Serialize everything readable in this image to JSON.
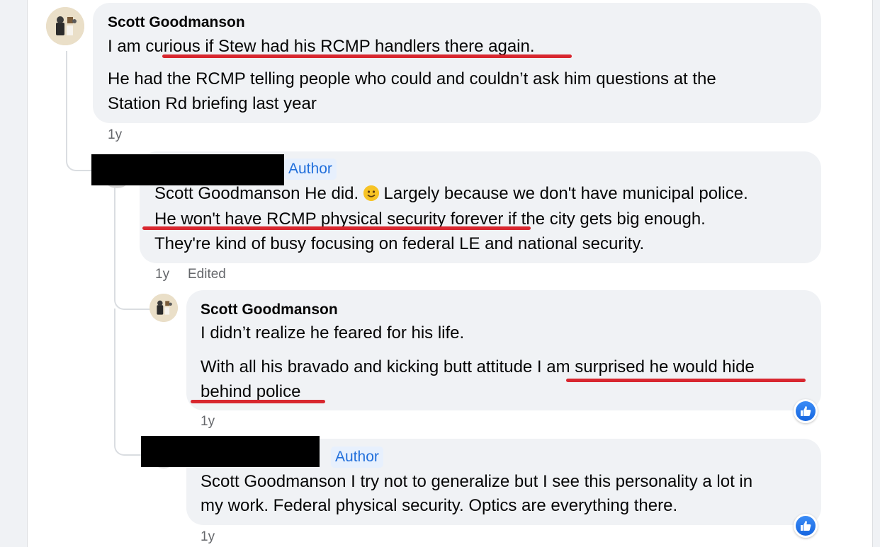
{
  "comment1": {
    "author": "Scott Goodmanson",
    "line1": "I am curious if Stew had his RCMP handlers there again.",
    "line2": "He had the RCMP telling people who could and couldn’t ask him questions at the",
    "line3": "Station Rd briefing last year",
    "time": "1y"
  },
  "reply1": {
    "badge": "Author",
    "line1_a": "Scott Goodmanson He did. ",
    "line1_b": " Largely because we don't have municipal police.",
    "line2": "He won't have RCMP physical security forever if the city gets big enough.",
    "line3": "They're kind of busy focusing on federal LE and national security.",
    "time": "1y",
    "edited": "Edited",
    "emoji_icon": "slightly-smiling-face-icon"
  },
  "reply2": {
    "author": "Scott Goodmanson",
    "line1": "I didn’t realize he feared for his life.",
    "line2": "With all his bravado and kicking butt attitude I am surprised he would hide",
    "line3": "behind police",
    "time": "1y",
    "reaction_icon": "like-icon"
  },
  "reply3": {
    "badge": "Author",
    "line1": "Scott Goodmanson I try not to generalize but I see this personality a lot in",
    "line2": "my work. Federal physical security. Optics are everything there.",
    "time": "1y",
    "reaction_icon": "like-icon"
  },
  "colors": {
    "bubble": "#f0f2f5",
    "author_badge_bg": "#e7f0fd",
    "author_badge_text": "#216fdb",
    "annotation_underline": "#d8272f",
    "like_blue": "#1877f2"
  }
}
